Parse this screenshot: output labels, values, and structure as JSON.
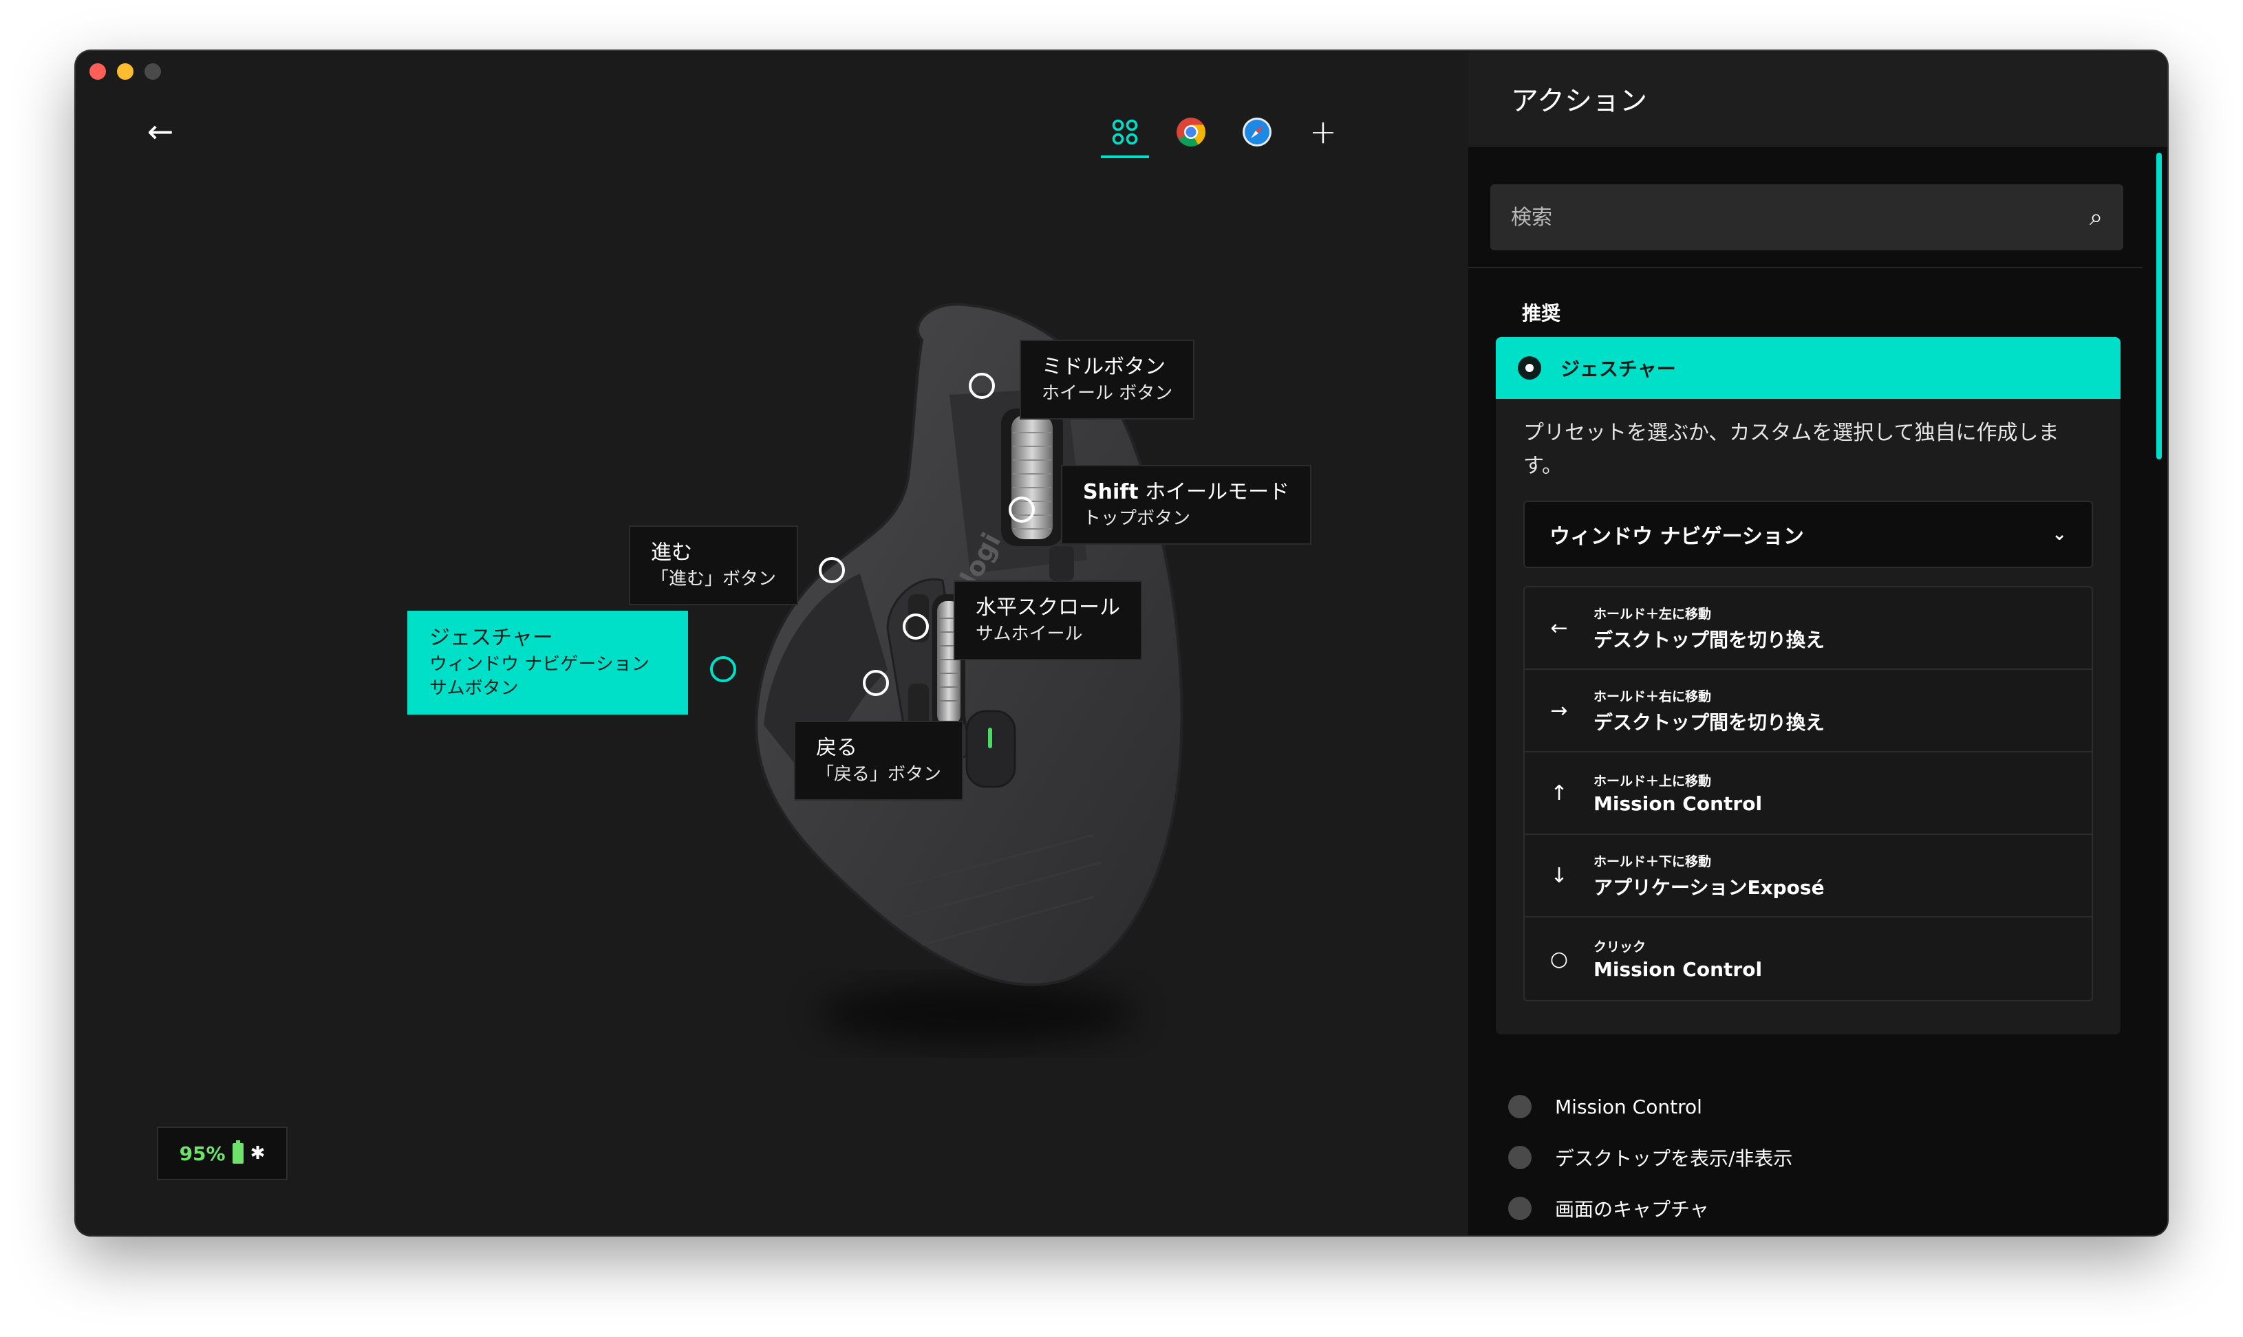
{
  "colors": {
    "accent": "#00e0c8",
    "window_bg": "#1b1b1b",
    "battery_green": "#6ee26b"
  },
  "toolbar": {
    "back_icon": "arrow-left-icon",
    "app_tabs": [
      {
        "name": "all-apps-icon",
        "active": true
      },
      {
        "name": "chrome-icon",
        "active": false
      },
      {
        "name": "safari-icon",
        "active": false
      },
      {
        "name": "add-app-icon",
        "active": false
      }
    ],
    "add_label": "+"
  },
  "callouts": {
    "middle": {
      "title": "ミドルボタン",
      "subtitle": "ホイール ボタン"
    },
    "shift": {
      "title_bold": "Shift",
      "title": " ホイールモード",
      "subtitle": "トップボタン"
    },
    "forward": {
      "title": "進む",
      "subtitle": "「進む」ボタン"
    },
    "hscroll": {
      "title": "水平スクロール",
      "subtitle": "サムホイール"
    },
    "gesture": {
      "title": "ジェスチャー",
      "line2": "ウィンドウ ナビゲーション",
      "subtitle": "サムボタン"
    },
    "back": {
      "title": "戻る",
      "subtitle": "「戻る」ボタン"
    }
  },
  "mouse": {
    "brand": "logi"
  },
  "battery": {
    "percent": "95%",
    "connection_icon": "bluetooth-icon"
  },
  "panel": {
    "title": "アクション",
    "search": {
      "placeholder": "検索",
      "value": ""
    },
    "section": "推奨",
    "gesture": {
      "label": "ジェスチャー",
      "description": "プリセットを選ぶか、カスタムを選択して独自に作成します。",
      "preset": "ウィンドウ ナビゲーション",
      "rows": [
        {
          "icon": "←",
          "small": "ホールド＋左に移動",
          "main": "デスクトップ間を切り換え"
        },
        {
          "icon": "→",
          "small": "ホールド＋右に移動",
          "main": "デスクトップ間を切り換え"
        },
        {
          "icon": "↑",
          "small": "ホールド＋上に移動",
          "main": "Mission Control"
        },
        {
          "icon": "↓",
          "small": "ホールド＋下に移動",
          "main": "アプリケーションExposé"
        },
        {
          "icon": "○",
          "small": "クリック",
          "main": "Mission Control"
        }
      ]
    },
    "other_actions": [
      "Mission Control",
      "デスクトップを表示/非表示",
      "画面のキャプチャ"
    ]
  }
}
